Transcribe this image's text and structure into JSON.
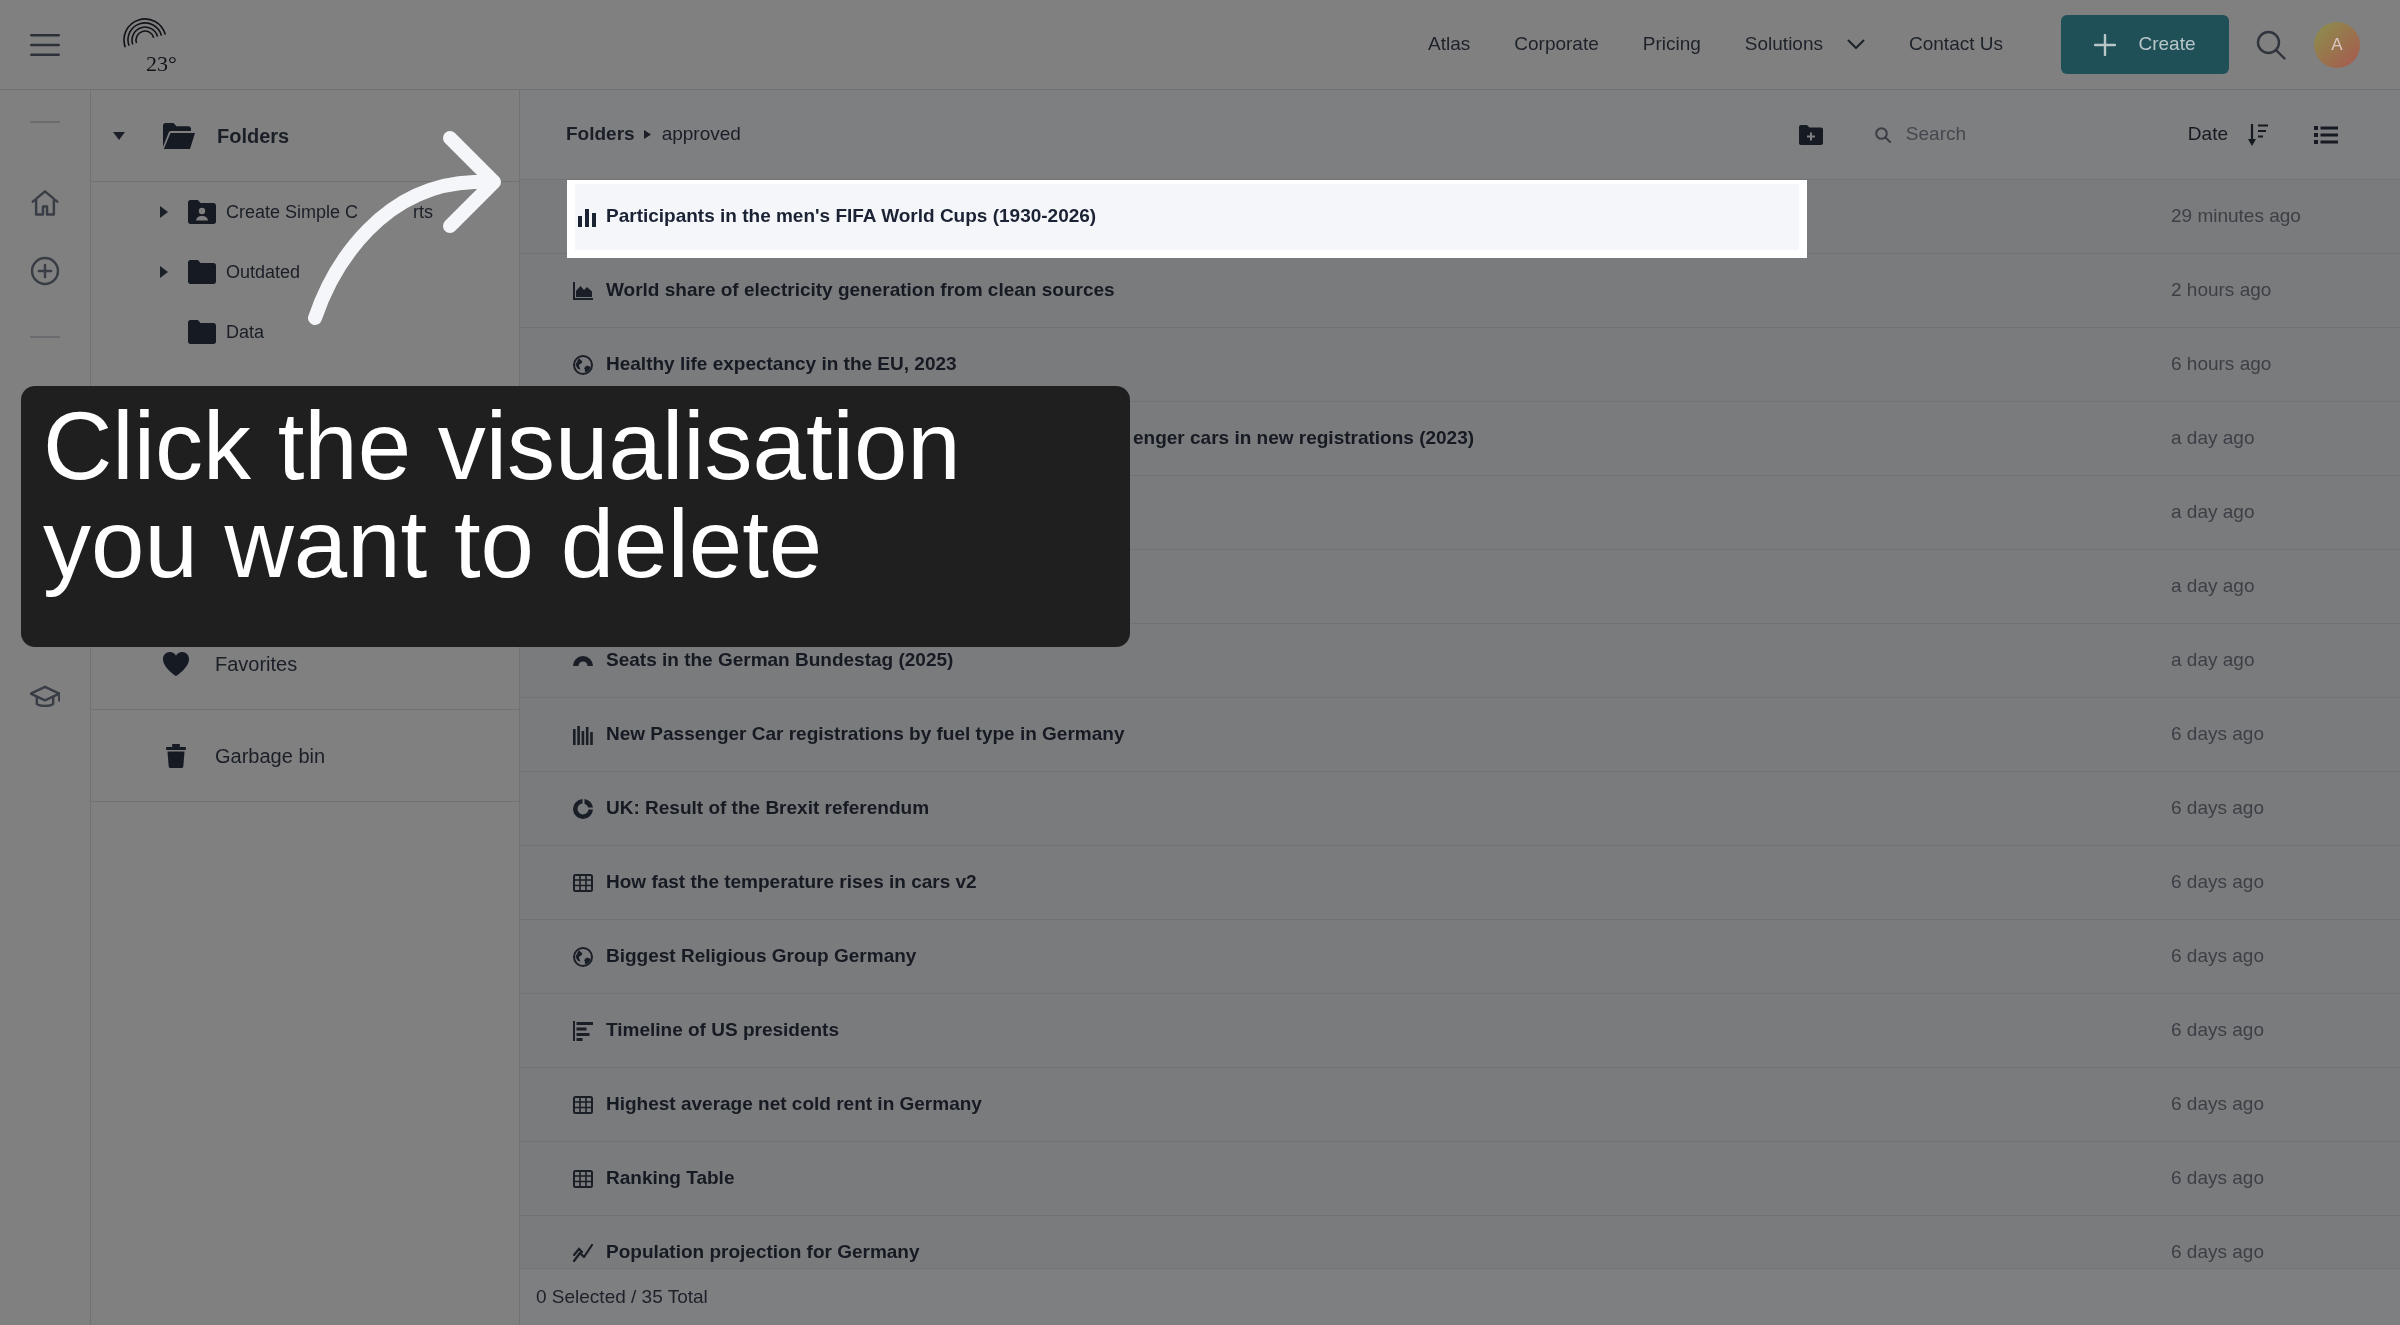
{
  "topbar": {
    "logo_text": "23°",
    "nav": [
      {
        "label": "Atlas",
        "dropdown": false
      },
      {
        "label": "Corporate",
        "dropdown": false
      },
      {
        "label": "Pricing",
        "dropdown": false
      },
      {
        "label": "Solutions",
        "dropdown": true
      },
      {
        "label": "Contact Us",
        "dropdown": false
      }
    ],
    "create_button": "Create",
    "avatar": "A"
  },
  "rail": {
    "groups": [
      {
        "items": [
          {
            "kind": "home",
            "selected": false
          },
          {
            "kind": "add",
            "selected": false
          }
        ]
      },
      {
        "items": [
          {
            "kind": "academy",
            "selected": false
          }
        ]
      }
    ]
  },
  "folders_tree": {
    "label": "Folders",
    "expanded": true,
    "children": [
      {
        "label": "Create Simple C",
        "label_end": "rts",
        "shared": true,
        "expanded": false
      },
      {
        "label": "Outdated",
        "shared": false,
        "expanded": false
      },
      {
        "label": "Data",
        "shared": false
      }
    ]
  },
  "sidebar_sections": [
    {
      "kind": "favorites",
      "label": "Favorites"
    },
    {
      "kind": "trash",
      "label": "Garbage bin"
    }
  ],
  "list": {
    "breadcrumb": [
      "Folders",
      "approved"
    ],
    "search": {
      "placeholder": "Search"
    },
    "sort": "Date",
    "rows": [
      {
        "kind": "bar",
        "title": "Participants in the men's FIFA World Cups (1930-2026)",
        "date": "29 minutes ago",
        "highlighted": true
      },
      {
        "kind": "area",
        "title": "World share of electricity generation from clean sources",
        "date": "2 hours ago",
        "highlighted": false
      },
      {
        "kind": "map",
        "title": "Healthy life expectancy in the EU, 2023",
        "date": "6 hours ago",
        "highlighted": false
      },
      {
        "title": "enger cars in new registrations (2023)",
        "date": "a day ago",
        "highlighted": false
      },
      {
        "date": "a day ago",
        "highlighted": false
      },
      {
        "date": "a day ago",
        "highlighted": false
      },
      {
        "kind": "parliament",
        "title": "Seats in the German Bundestag (2025)",
        "date": "a day ago",
        "highlighted": false
      },
      {
        "kind": "column",
        "title": "New Passenger Car registrations by fuel type in Germany",
        "date": "6 days ago",
        "highlighted": false
      },
      {
        "kind": "donut",
        "title": "UK: Result of the Brexit referendum",
        "date": "6 days ago",
        "highlighted": false
      },
      {
        "kind": "table",
        "title": "How fast the temperature rises in cars v2",
        "date": "6 days ago",
        "highlighted": false
      },
      {
        "kind": "map",
        "title": "Biggest Religious Group Germany",
        "date": "6 days ago",
        "highlighted": false
      },
      {
        "kind": "timeline",
        "title": "Timeline of US presidents",
        "date": "6 days ago",
        "highlighted": false
      },
      {
        "kind": "table",
        "title": "Highest average net cold rent in Germany",
        "date": "6 days ago",
        "highlighted": false
      },
      {
        "kind": "table",
        "title": "Ranking Table",
        "date": "6 days ago",
        "highlighted": false
      },
      {
        "kind": "line",
        "title": "Population projection for Germany",
        "date": "6 days ago",
        "highlighted": false
      }
    ],
    "footer": "0 Selected / 35 Total"
  },
  "tour": {
    "text": "Click the visualisation you want to delete"
  }
}
